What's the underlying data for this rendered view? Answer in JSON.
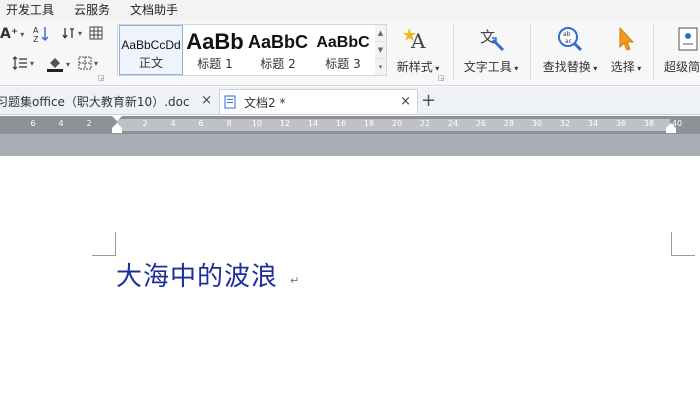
{
  "menu": {
    "items": [
      "开发工具",
      "云服务",
      "文档助手"
    ]
  },
  "ribbon": {
    "font_size_up": "A⁺",
    "styles": [
      {
        "sample": "AaBbCcDd",
        "name": "正文"
      },
      {
        "sample": "AaBb",
        "name": "标题 1"
      },
      {
        "sample": "AaBbC",
        "name": "标题 2"
      },
      {
        "sample": "AaBbC",
        "name": "标题 3"
      }
    ],
    "new_style": "新样式",
    "text_tools": "文字工具",
    "find_replace": "查找替换",
    "select": "选择",
    "super": "超级简"
  },
  "tabs": [
    {
      "label": "习题集office（职大教育新10）.doc"
    },
    {
      "label": "文档2 *"
    }
  ],
  "ruler": {
    "ticks": [
      "6",
      "4",
      "2",
      "2",
      "4",
      "6",
      "8",
      "10",
      "12",
      "14",
      "16",
      "18",
      "20",
      "22",
      "24",
      "26",
      "28",
      "30",
      "32",
      "34",
      "36",
      "38",
      "40"
    ]
  },
  "document": {
    "title": "大海中的波浪"
  },
  "colors": {
    "title": "#1c2f9c",
    "ruler": "#8e9198"
  }
}
